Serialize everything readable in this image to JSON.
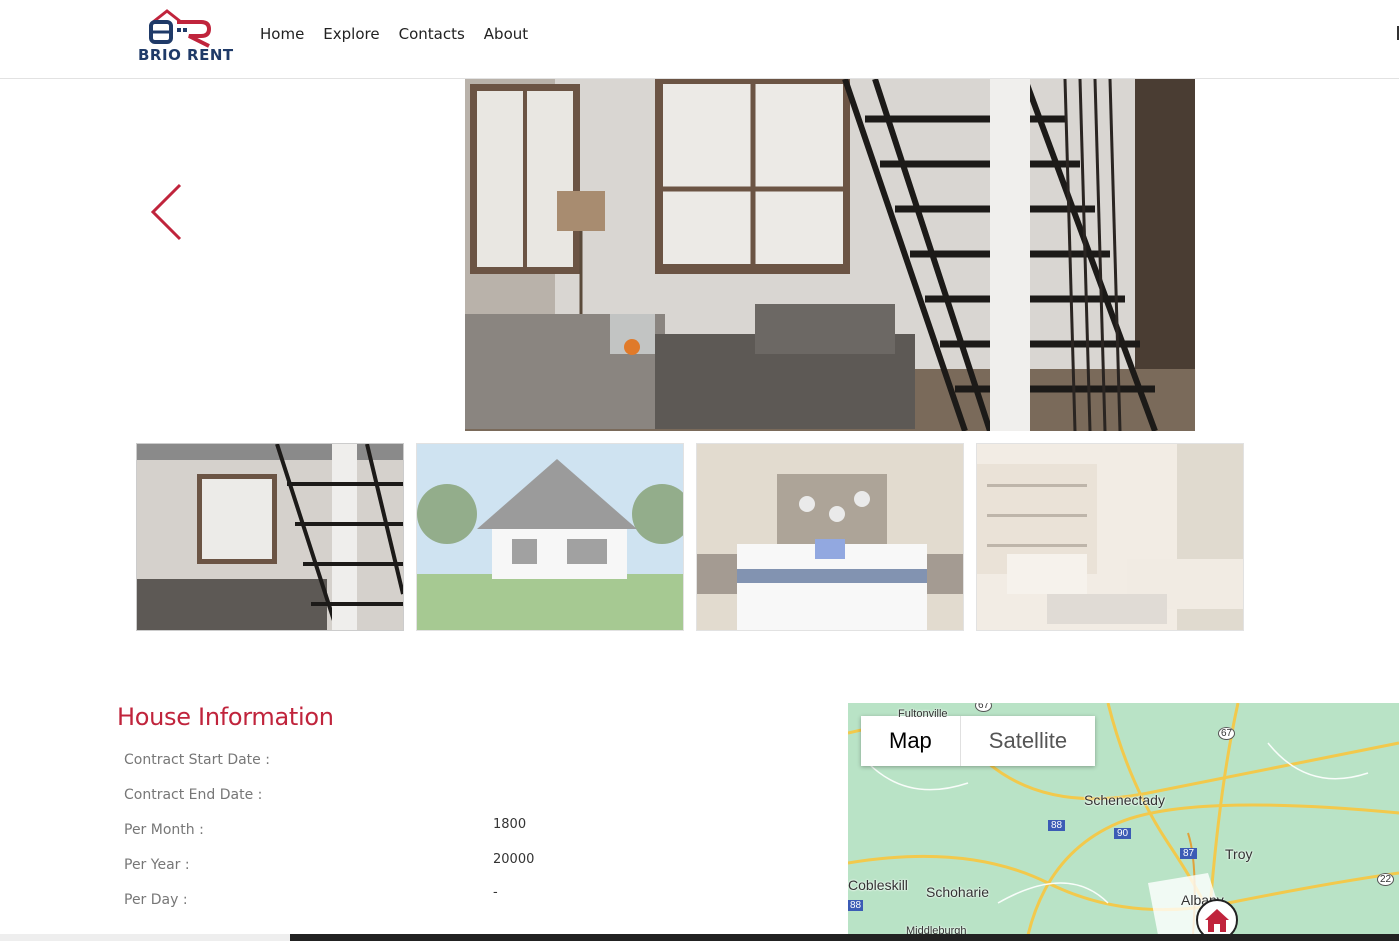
{
  "brand": {
    "name": "BRIO RENT",
    "colors": {
      "primary": "#1f3a68",
      "accent": "#c0243c"
    }
  },
  "nav": {
    "items": [
      "Home",
      "Explore",
      "Contacts",
      "About"
    ]
  },
  "carousel": {
    "prev_icon": "chevron-left-icon",
    "thumbnails": [
      "living-room-stairs",
      "house-exterior",
      "bedroom",
      "lounge"
    ]
  },
  "house_info": {
    "title": "House Information",
    "rows": [
      {
        "label": "Contract Start Date :",
        "value": ""
      },
      {
        "label": "Contract End Date :",
        "value": ""
      },
      {
        "label": "Per Month :",
        "value": "1800"
      },
      {
        "label": "Per Year :",
        "value": "20000"
      },
      {
        "label": "Per Day :",
        "value": "-"
      }
    ]
  },
  "map": {
    "type_buttons": {
      "map": "Map",
      "satellite": "Satellite"
    },
    "places": [
      "Schenectady",
      "Troy",
      "Cobleskill",
      "Schoharie",
      "Albany",
      "Fultonville",
      "Middleburgh"
    ],
    "shields": [
      "88",
      "90",
      "87",
      "67",
      "22",
      "67",
      "88"
    ],
    "marker_icon": "home-icon"
  }
}
